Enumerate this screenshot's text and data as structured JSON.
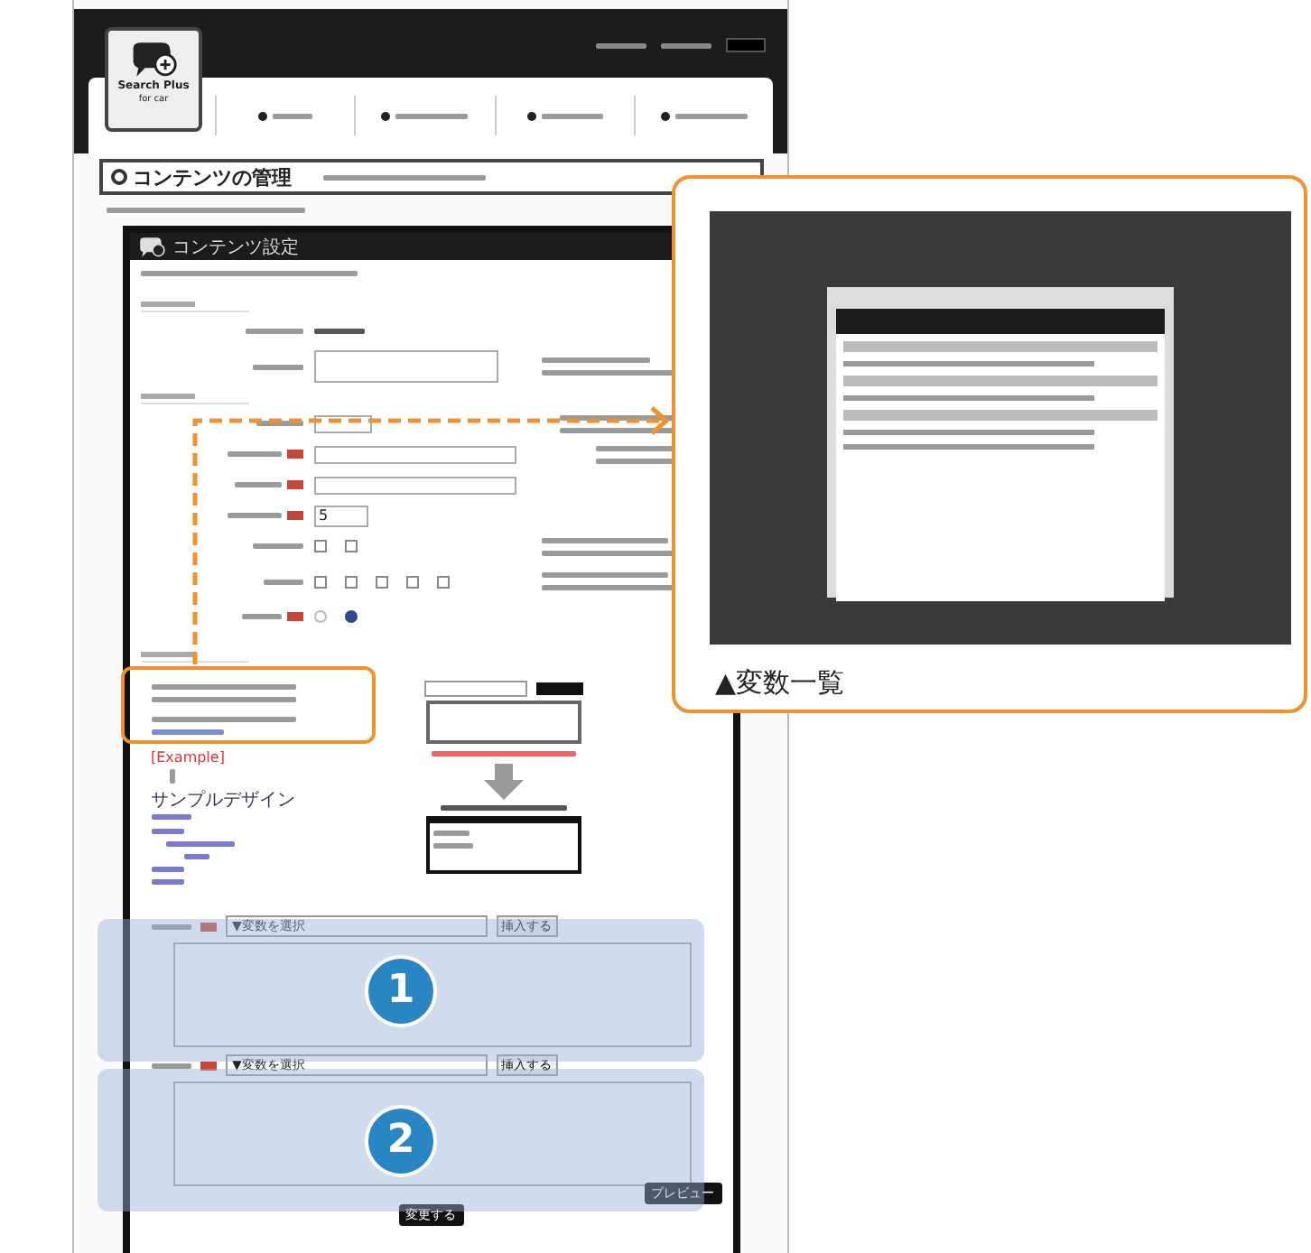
{
  "logo": {
    "name": "Search Plus",
    "sub": "for car"
  },
  "page_title": "コンテンツの管理",
  "panel_title": "コンテンツ設定",
  "form": {
    "display_count": "5",
    "filter_options": [
      {
        "checked": false
      },
      {
        "checked": false
      }
    ],
    "type_options": [
      {
        "checked": false
      },
      {
        "checked": false
      },
      {
        "checked": false
      },
      {
        "checked": false
      },
      {
        "checked": false
      }
    ],
    "visibility": [
      {
        "selected": false
      },
      {
        "selected": true
      }
    ]
  },
  "template": {
    "example_label": "[Example]",
    "sample": "サンプルデザイン"
  },
  "html_fields": [
    {
      "select": "▼変数を選択",
      "button": "挿入する",
      "callout": "1"
    },
    {
      "select": "▼変数を選択",
      "button": "挿入する",
      "callout": "2"
    }
  ],
  "buttons": {
    "preview": "プレビュー",
    "submit": "変更する"
  },
  "inset": {
    "caption": "▲変数一覧"
  }
}
